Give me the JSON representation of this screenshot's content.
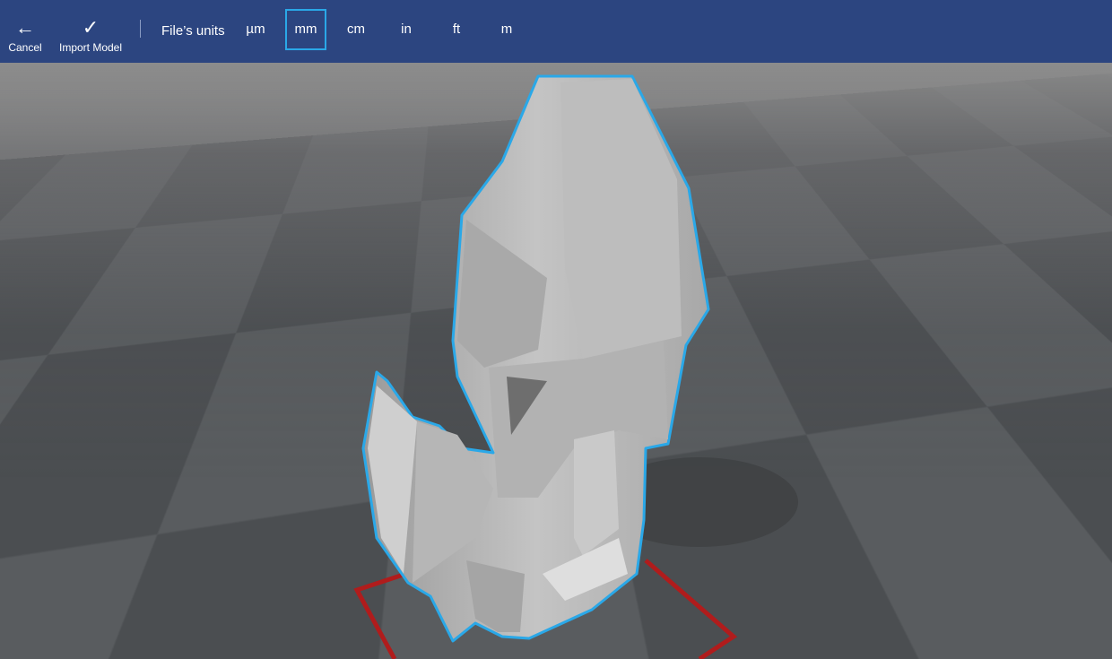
{
  "toolbar": {
    "cancel_label": "Cancel",
    "cancel_icon": "arrow-left-icon",
    "import_label": "Import Model",
    "import_icon": "checkmark-icon",
    "units_label": "File’s units",
    "units": [
      "µm",
      "mm",
      "cm",
      "in",
      "ft",
      "m"
    ],
    "selected_unit": "mm"
  },
  "colors": {
    "toolbar": "#2c4580",
    "selection": "#2aa8e8",
    "bounds": "#b01c1c"
  }
}
